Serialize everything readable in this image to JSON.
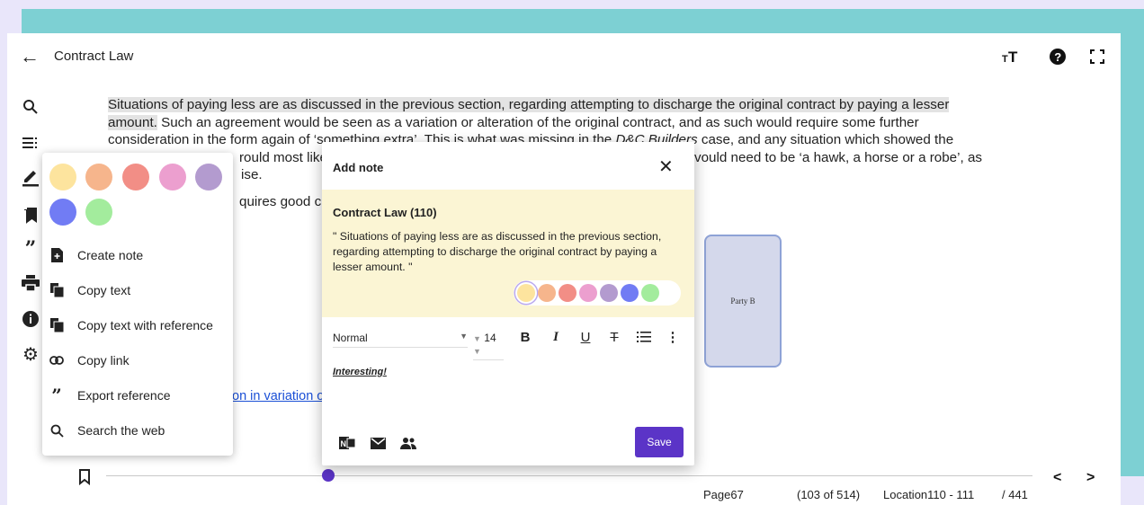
{
  "app": {
    "title": "Contract Law"
  },
  "content": {
    "highlighted_line1": "Situations of paying less are as discussed in the previous section, regarding attempting to discharge the original contract by paying a lesser",
    "highlighted_line2": "amount.",
    "line2_rest": " Such an agreement would be seen as a variation or alteration of the original contract, and as such would require some further",
    "line3_a": "consideration in the form again of ‘something extra’. This is what was missing in the ",
    "line3_italic": "D&C Builders",
    "line3_b": " case, and any situation which showed the",
    "line4_a": "rould most like",
    "line4_b": "vould need to be ‘a hawk, a horse or a robe’, as",
    "line5": "ise.",
    "line6": "quires good c",
    "link_text": "on in variation o"
  },
  "diagram": {
    "party_b": "Party B"
  },
  "context_menu": {
    "swatch_colors": [
      "#fde49e",
      "#f6b58c",
      "#f28e86",
      "#ec9fcf",
      "#b39bcf",
      "#717cf4",
      "#a3ec9d"
    ],
    "items": [
      {
        "label": "Create note",
        "icon": "note-add-icon"
      },
      {
        "label": "Copy text",
        "icon": "copy-icon"
      },
      {
        "label": "Copy text with reference",
        "icon": "copy-icon"
      },
      {
        "label": "Copy link",
        "icon": "link-icon"
      },
      {
        "label": "Export reference",
        "icon": "quote-icon"
      },
      {
        "label": "Search the web",
        "icon": "search-icon"
      }
    ]
  },
  "dialog": {
    "title": "Add note",
    "quote_title": "Contract Law (110)",
    "quote_text": "\" Situations of paying less are as discussed in the previous section, regarding attempting to discharge the original contract by paying a lesser amount.  \"",
    "note_colors": [
      "#fde49e",
      "#f6b58c",
      "#f28e86",
      "#ec9fcf",
      "#b39bcf",
      "#717cf4",
      "#a3ec9d"
    ],
    "selected_color_index": 0,
    "toolbar": {
      "style": "Normal",
      "size": "14"
    },
    "editor_text": "Interesting!",
    "save_label": "Save"
  },
  "footer": {
    "page": "Page67",
    "page_count": "(103 of 514)",
    "location": "Location110 - 111",
    "total": "/ 441",
    "progress": 0.24
  }
}
